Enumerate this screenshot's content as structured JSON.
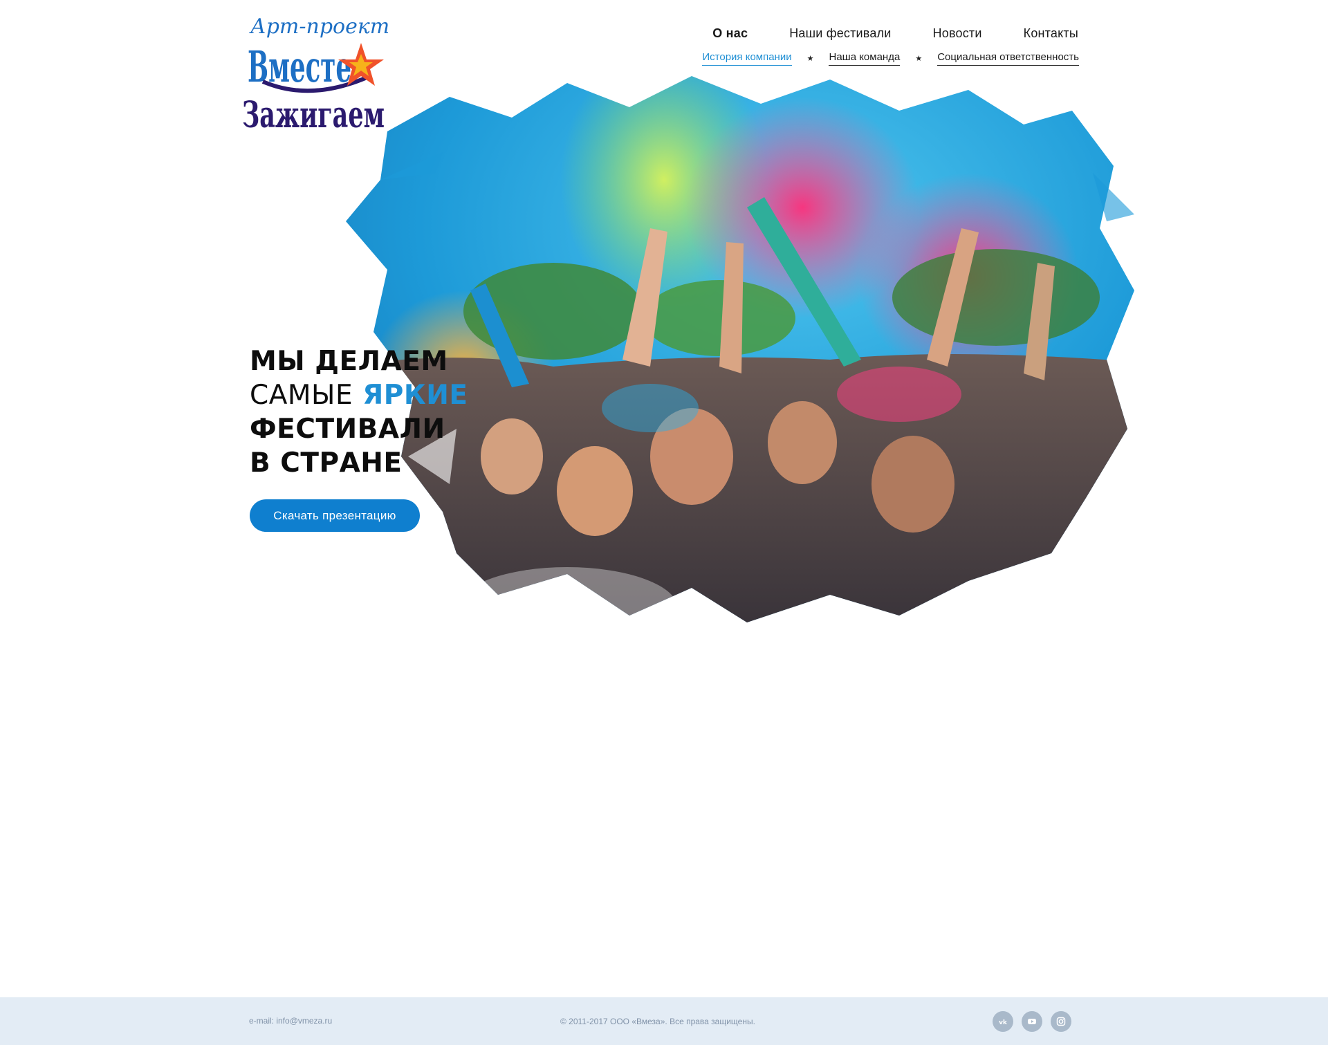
{
  "logo": {
    "line1": "Арт-проект",
    "line2": "Вместе",
    "line3": "Зажигаем",
    "colors": {
      "blue": "#1d6fc4",
      "purple": "#2b1a6e",
      "star": "#f0522a",
      "star_inner": "#f7b21a"
    }
  },
  "nav": {
    "main": [
      {
        "label": "О нас",
        "active": true
      },
      {
        "label": "Наши фестивали"
      },
      {
        "label": "Новости"
      },
      {
        "label": "Контакты"
      }
    ],
    "sub": [
      {
        "label": "История компании",
        "current": true
      },
      {
        "label": "Наша команда"
      },
      {
        "label": "Социальная ответственность"
      }
    ],
    "separator": "★"
  },
  "hero": {
    "line1": "МЫ ДЕЛАЕМ",
    "line2a": "САМЫЕ",
    "line2b": "ЯРКИЕ",
    "line3": "ФЕСТИВАЛИ",
    "line4": "В СТРАНЕ",
    "cta": "Скачать презентацию",
    "image": "festival-color-powder-crowd",
    "colors": {
      "accent": "#1f8fd4",
      "button": "#0f7fcf",
      "text": "#0d0d0d"
    }
  },
  "footer": {
    "email": "e-mail: info@vmeza.ru",
    "copyright": "© 2011-2017   ООО «Вмеза». Все права защищены.",
    "social": [
      {
        "name": "vk-icon",
        "label": "VK"
      },
      {
        "name": "youtube-icon",
        "label": "YouTube"
      },
      {
        "name": "instagram-icon",
        "label": "Instagram"
      }
    ],
    "colors": {
      "background": "#e3ecf5",
      "text": "#8092a8",
      "icon": "#a9b9ca"
    }
  }
}
